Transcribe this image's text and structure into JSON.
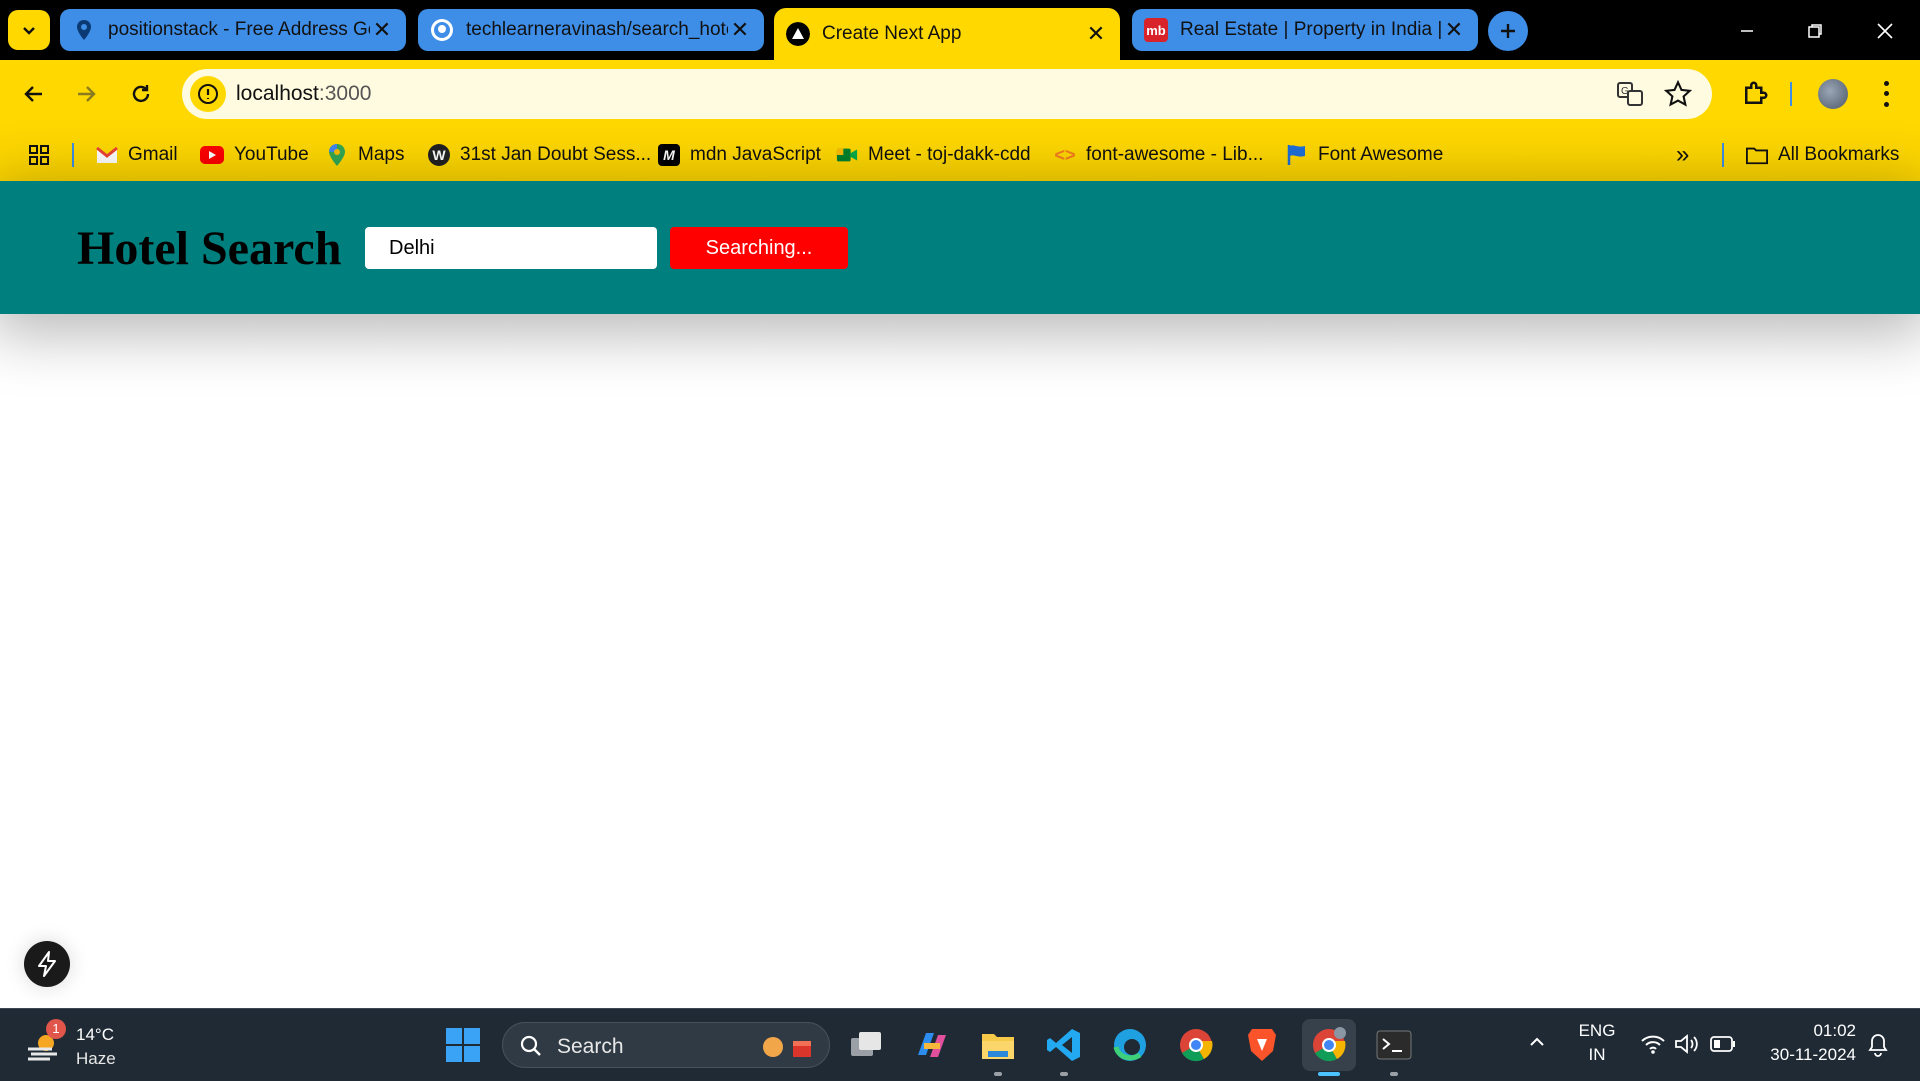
{
  "browser": {
    "tabs": [
      {
        "title": "positionstack - Free Address Ge",
        "favicon": "map-pin-icon",
        "active": false
      },
      {
        "title": "techlearneravinash/search_hote",
        "favicon": "github-icon",
        "active": false
      },
      {
        "title": "Create Next App",
        "favicon": "nextjs-icon",
        "active": true
      },
      {
        "title": "Real Estate | Property in India | ",
        "favicon": "magicbricks-icon",
        "favicon_text": "mb",
        "active": false
      }
    ],
    "url_host": "localhost",
    "url_port": ":3000",
    "accent_color": "#ffd800"
  },
  "bookmarks": {
    "items": [
      {
        "label": "Gmail"
      },
      {
        "label": "YouTube"
      },
      {
        "label": "Maps"
      },
      {
        "label": "31st Jan Doubt Sess..."
      },
      {
        "label": "mdn JavaScript"
      },
      {
        "label": "Meet - toj-dakk-cdd"
      },
      {
        "label": "font-awesome - Lib..."
      },
      {
        "label": "Font Awesome"
      }
    ],
    "all_bookmarks": "All Bookmarks"
  },
  "app": {
    "title": "Hotel Search",
    "search_value": "Delhi",
    "search_button": "Searching...",
    "header_color": "#007f7f",
    "button_color": "#ff0000"
  },
  "taskbar": {
    "weather_temp": "14°C",
    "weather_desc": "Haze",
    "weather_badge": "1",
    "search_label": "Search",
    "lang_top": "ENG",
    "lang_bottom": "IN",
    "time": "01:02",
    "date": "30-11-2024"
  }
}
